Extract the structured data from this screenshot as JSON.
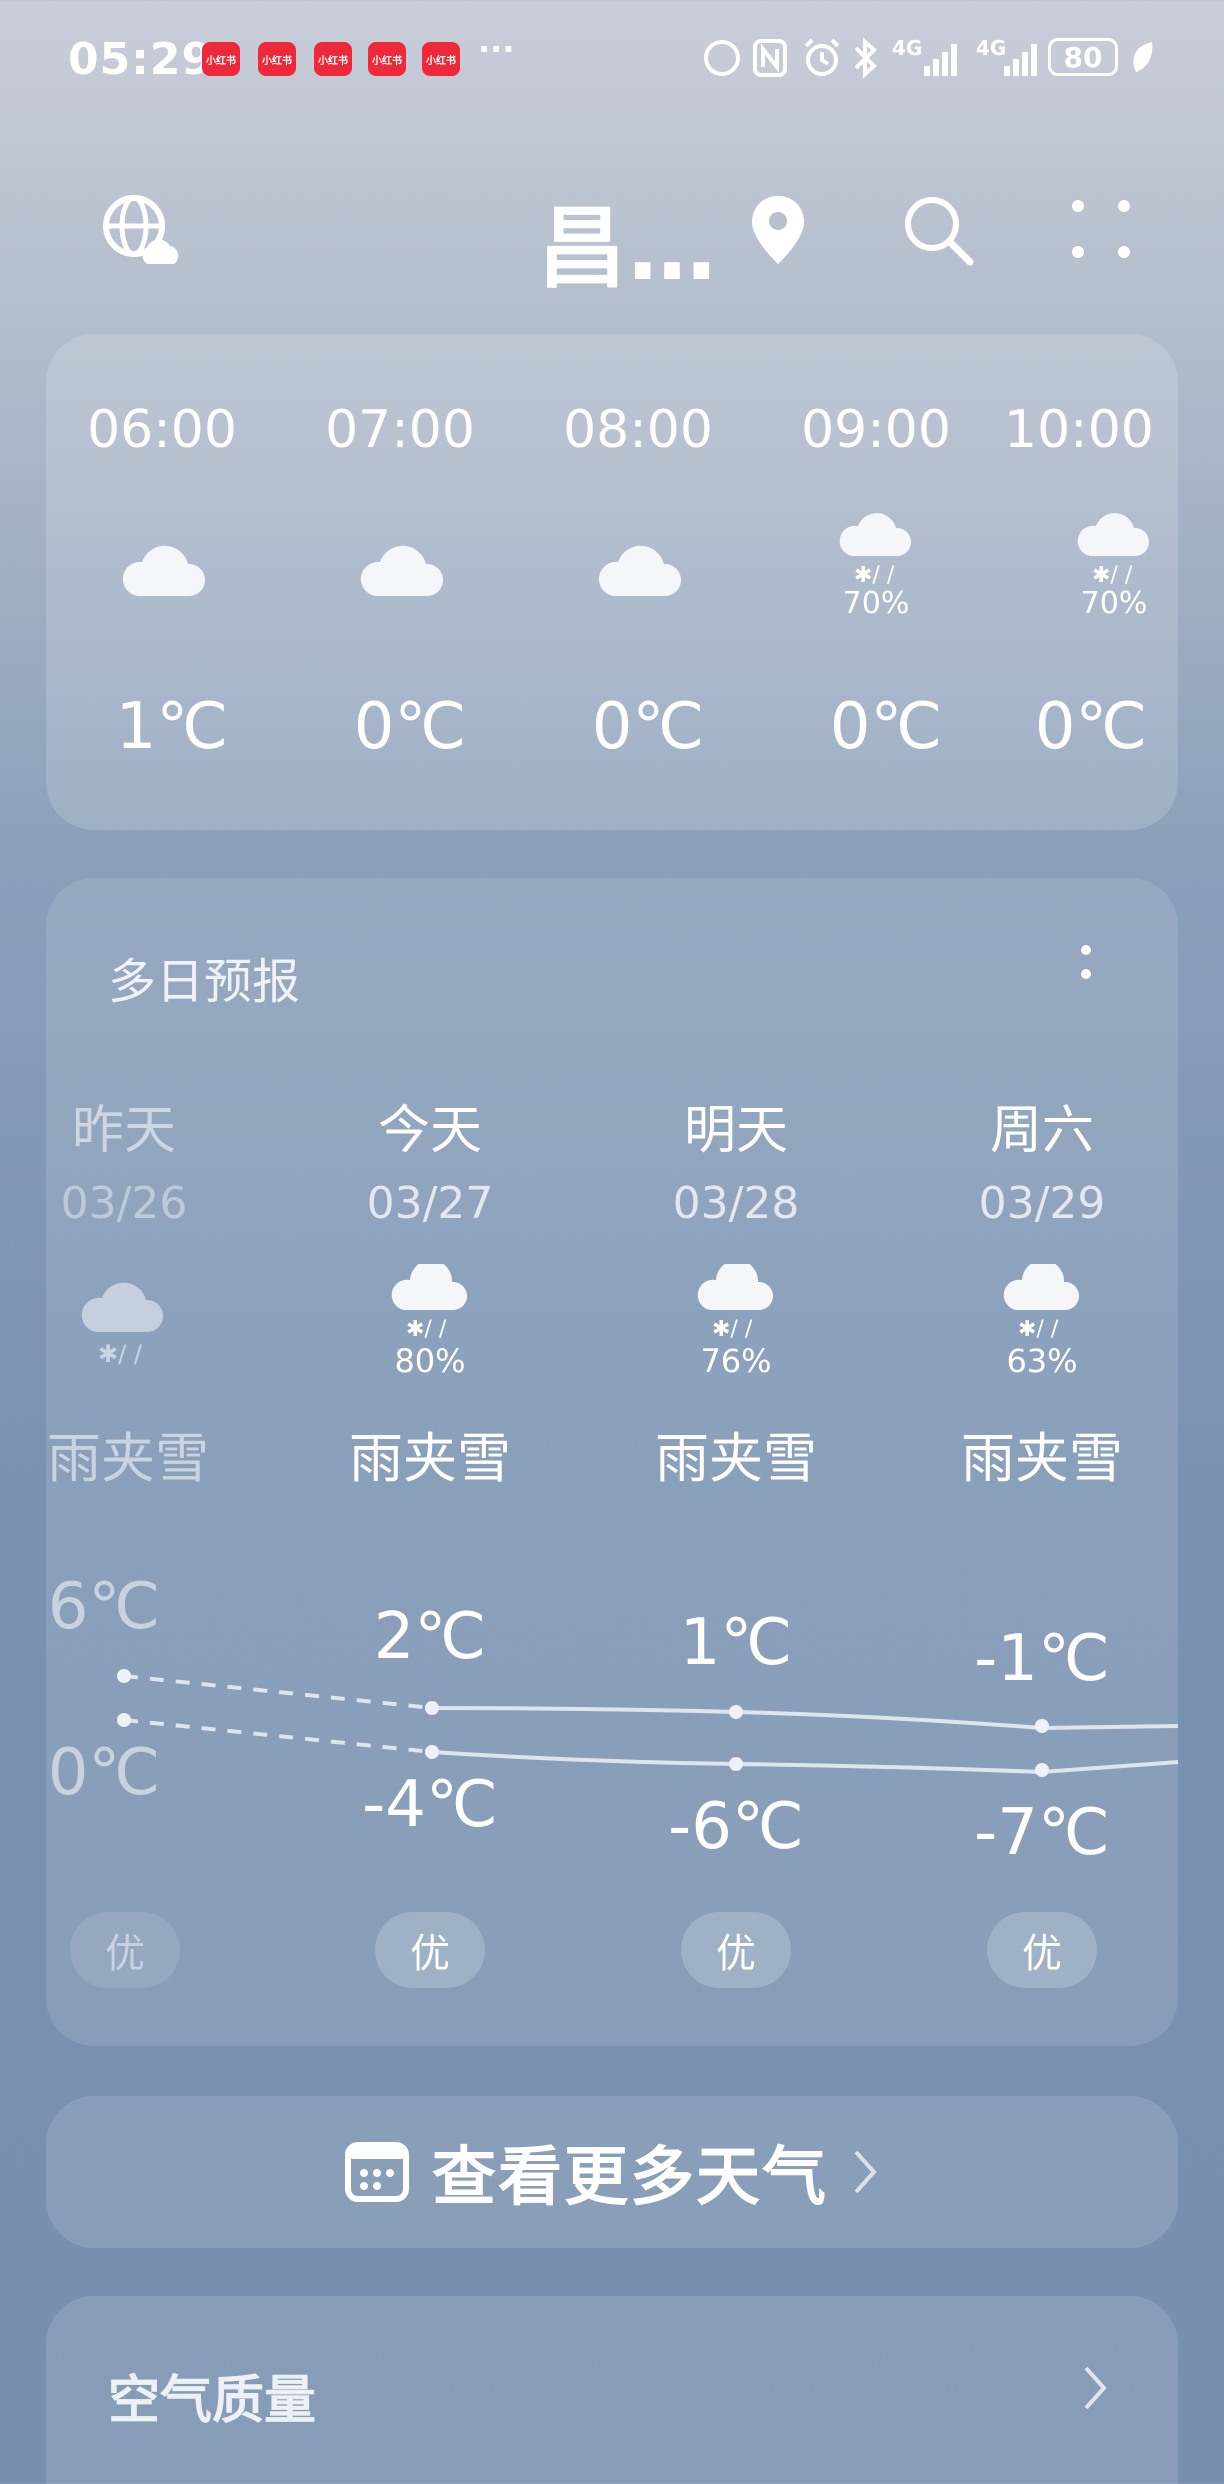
{
  "status_bar": {
    "time": "05:29",
    "app_badge_label": "小红书",
    "more": "···",
    "network_1": "4G",
    "network_2": "4G",
    "battery": "80"
  },
  "header": {
    "city": "昌…"
  },
  "hourly": [
    {
      "time": "06:00",
      "icon": "cloud-icon",
      "pct": "",
      "temp": "1℃"
    },
    {
      "time": "07:00",
      "icon": "cloud-icon",
      "pct": "",
      "temp": "0℃"
    },
    {
      "time": "08:00",
      "icon": "cloud-icon",
      "pct": "",
      "temp": "0℃"
    },
    {
      "time": "09:00",
      "icon": "sleet-icon",
      "pct": "70%",
      "temp": "0℃"
    },
    {
      "time": "10:00",
      "icon": "sleet-icon",
      "pct": "70%",
      "temp": "0℃"
    }
  ],
  "multi_day": {
    "title": "多日预报",
    "days": [
      {
        "label": "昨天",
        "date": "03/26",
        "icon": "sleet-icon",
        "pct": "",
        "cond": "雨夹雪",
        "high": "6℃",
        "low": "0℃",
        "aqi": "优"
      },
      {
        "label": "今天",
        "date": "03/27",
        "icon": "sleet-icon",
        "pct": "80%",
        "cond": "雨夹雪",
        "high": "2℃",
        "low": "-4℃",
        "aqi": "优"
      },
      {
        "label": "明天",
        "date": "03/28",
        "icon": "sleet-icon",
        "pct": "76%",
        "cond": "雨夹雪",
        "high": "1℃",
        "low": "-6℃",
        "aqi": "优"
      },
      {
        "label": "周六",
        "date": "03/29",
        "icon": "sleet-icon",
        "pct": "63%",
        "cond": "雨夹雪",
        "high": "-1℃",
        "low": "-7℃",
        "aqi": "优"
      }
    ]
  },
  "more_weather": {
    "label": "查看更多天气"
  },
  "air_quality": {
    "title": "空气质量"
  },
  "colors": {
    "badge": "#ee2a3a",
    "curve": "#dfe5ee"
  }
}
